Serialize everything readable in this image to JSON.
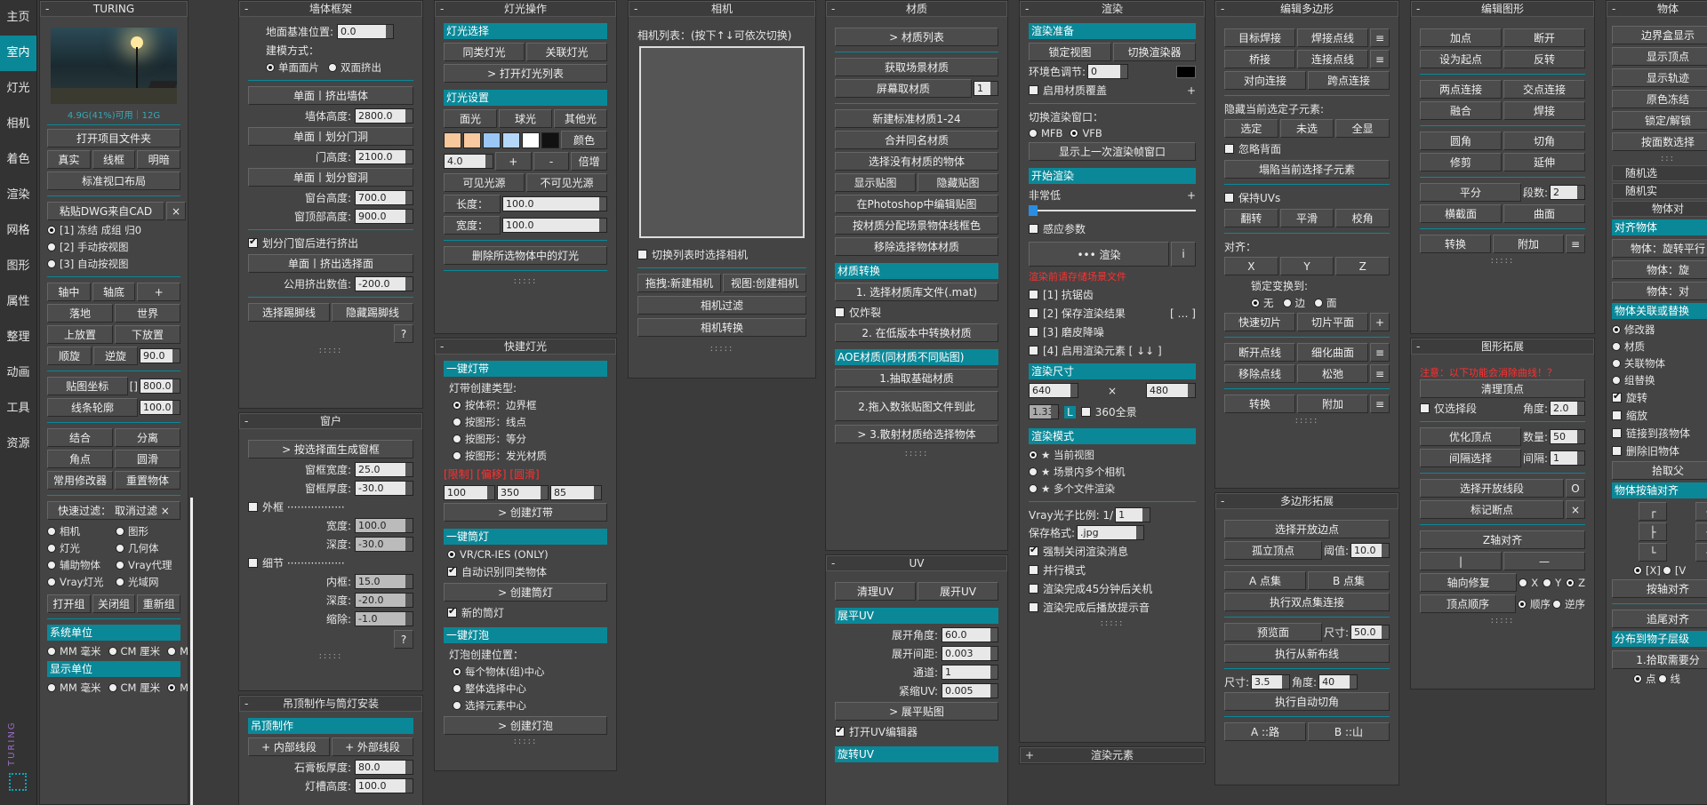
{
  "nav": {
    "items": [
      "主页",
      "室内",
      "灯光",
      "相机",
      "着色",
      "渲染",
      "网格",
      "图形",
      "属性",
      "整理",
      "动画",
      "工具",
      "资源"
    ],
    "active": "室内",
    "logo": "TURING"
  },
  "turing": {
    "title": "TURING",
    "mem": "4.9G(41%)可用｜12G",
    "open_folder": "打开项目文件夹",
    "modes": [
      "真实",
      "线框",
      "明暗"
    ],
    "std_layout": "标准视口布局",
    "paste_dwg": "粘贴DWG来自CAD",
    "close": "×",
    "paste_opts": [
      "[1] 冻结 成组 归0",
      "[2] 手动按视图",
      "[3] 自动按视图"
    ],
    "axis": [
      "轴中",
      "轴底",
      "+"
    ],
    "ground": "落地",
    "world": "世界",
    "up": "上放置",
    "down": "下放置",
    "cw": "顺旋",
    "ccw": "逆旋",
    "rot": "90.0",
    "map_coord": "贴图坐标",
    "bracket": "[]",
    "map_val": "800.0",
    "outline": "线条轮廓",
    "outline_val": "100.0",
    "combine": "结合",
    "separate": "分离",
    "corner": "角点",
    "smooth": "圆滑",
    "common_mod": "常用修改器",
    "reset_obj": "重置物体",
    "filter": "快速过滤：  取消过滤 ×",
    "filters": [
      "相机",
      "图形",
      "灯光",
      "几何体",
      "辅助物体",
      "Vray代理",
      "Vray灯光",
      "光域网"
    ],
    "group_btns": [
      "打开组",
      "关闭组",
      "重新组"
    ],
    "sys_unit": "系统单位",
    "units": [
      "MM 毫米",
      "CM 厘米",
      "M 米"
    ],
    "disp_unit": "显示单位"
  },
  "wall": {
    "title": "墙体框架",
    "base_label": "地面基准位置:",
    "base_val": "0.0",
    "method": "建模方式：",
    "m1": "单面面片",
    "m2": "双面挤出",
    "b1": "单面丨挤出墙体",
    "wh_label": "墙体高度:",
    "wh": "2800.0",
    "b2": "单面丨划分门洞",
    "dh_label": "门高度:",
    "dh": "2100.0",
    "b3": "单面丨划分窗洞",
    "sill_label": "窗台高度:",
    "sill": "700.0",
    "top_label": "窗顶部高度:",
    "top": "900.0",
    "split": "划分门窗后进行挤出",
    "b4": "单面丨挤出选择面",
    "pub_label": "公用挤出数值:",
    "pub": "-200.0",
    "sel_kick": "选择踢脚线",
    "hide_kick": "隐藏踢脚线",
    "q": "?",
    "win_title": "窗户",
    "win_gen": "> 按选择面生成窗框",
    "wf_w_l": "窗框宽度:",
    "wf_w": "25.0",
    "wf_d_l": "窗框厚度:",
    "wf_d": "-30.0",
    "outer": "外框 ·················",
    "ow_l": "宽度:",
    "ow": "100.0",
    "od_l": "深度:",
    "od": "-30.0",
    "detail": "细节 ·················",
    "iw_l": "内框:",
    "iw": "15.0",
    "id_l": "深度:",
    "id": "-20.0",
    "sh_l": "缩除:",
    "sh": "-1.0",
    "ceiling_title": "吊顶制作与筒灯安装",
    "ceil_sec": "吊顶制作",
    "inner_line": "+ 内部线段",
    "outer_line": "+ 外部线段",
    "gyp_l": "石膏板厚度:",
    "gyp": "80.0",
    "lb_l": "灯槽高度:",
    "lb": "100.0"
  },
  "light": {
    "title": "灯光操作",
    "sel_sec": "灯光选择",
    "same": "同类灯光",
    "assoc": "关联灯光",
    "open_list": "> 打开灯光列表",
    "set_sec": "灯光设置",
    "types": [
      "面光",
      "球光",
      "其他光"
    ],
    "swatches": [
      "#f7c89b",
      "#f9c8a0",
      "#9ac6f6",
      "#b4d6f9",
      "#ffffff",
      "#111111"
    ],
    "color": "颜色",
    "mult": "4.0",
    "plus": "+",
    "minus": "-",
    "fold": "倍增",
    "vis": "可见光源",
    "invis": "不可见光源",
    "len_l": "长度：",
    "len": "100.0",
    "wid_l": "宽度：",
    "wid": "100.0",
    "del_all": "删除所选物体中的灯光",
    "quick_title": "快建灯光",
    "strip_sec": "一键灯带",
    "strip_type": "灯带创建类型:",
    "strip_opts": [
      "按体积：边界框",
      "按图形：线点",
      "按图形：等分",
      "按图形：发光材质"
    ],
    "strip_red": "[限制] [偏移] [圆滑]",
    "s1": "100",
    "s2": "350",
    "s3": "85",
    "create_strip": "> 创建灯带",
    "tube_sec": "一键筒灯",
    "tube_opt": "VR/CR-IES (ONLY)",
    "tube_auto": "自动识别同类物体",
    "create_tube": "> 创建筒灯",
    "new_tube": "新的筒灯",
    "bulb_sec": "一键灯泡",
    "bulb_pos": "灯泡创建位置：",
    "bulb_opts": [
      "每个物体(组)中心",
      "整体选择中心",
      "选择元素中心"
    ],
    "create_bulb": "> 创建灯泡"
  },
  "camera": {
    "title": "相机",
    "list": "相机列表：(按下↑↓可依次切换)",
    "toggle": "切换列表时选择相机",
    "drag": "拖拽:新建相机",
    "view": "视图:创建相机",
    "filter": "相机过滤",
    "convert": "相机转换"
  },
  "material": {
    "title": "材质",
    "list": "> 材质列表",
    "get_scene": "获取场景材质",
    "screen": "屏幕取材质",
    "screen_n": "1",
    "new_std": "新建标准材质1-24",
    "merge": "合并同名材质",
    "sel_nomat": "选择没有材质的物体",
    "show_map": "显示贴图",
    "hide_map": "隐藏贴图",
    "ps_edit": "在Photoshop中编辑贴图",
    "assign_color": "按材质分配场景物体线框色",
    "remove": "移除选择物体材质",
    "conv_sec": "材质转换",
    "c1": "1. 选择材质库文件(.mat)",
    "only_bake": "仅炸裂",
    "c2": "2. 在低版本中转换材质",
    "aoe_sec": "AOE材质(同材质不同贴图)",
    "a1": "1.抽取基础材质",
    "a2": "2.拖入数张贴图文件到此",
    "a3": "> 3.散射材质给选择物体",
    "uv_title": "UV",
    "clear_uv": "清理UV",
    "unwrap": "展开UV",
    "unwrap_sec": "展平UV",
    "ua_l": "展开角度:",
    "ua": "60.0",
    "ud_l": "展开间距:",
    "ud": "0.003",
    "ch_l": "通道:",
    "ch": "1",
    "tight_l": "紧缩UV:",
    "tight": "0.005",
    "flat_map": "> 展平贴图",
    "open_uv": "打开UV编辑器",
    "rot_sec": "旋转UV"
  },
  "render": {
    "title": "渲染",
    "prep_sec": "渲染准备",
    "lock_view": "锁定视图",
    "switch_r": "切换渲染器",
    "env_l": "环境色调节:",
    "env": "0",
    "override": "启用材质覆盖",
    "plus": "+",
    "switch_win": "切换渲染窗口：",
    "mfb": "MFB",
    "vfb": "VFB",
    "show_last": "显示上一次渲染帧窗口",
    "start_sec": "开始渲染",
    "quality": "非常低",
    "sens": "感应参数",
    "render_btn": "••• 渲染",
    "info": "i",
    "red_note": "渲染前请存储场景文件",
    "o1": "[1] 抗锯齿",
    "o2": "[2] 保存渲染结果",
    "o2b": "[ … ]",
    "o3": "[3] 磨皮降噪",
    "o4": "[4] 启用渲染元素 [ ↓↓ ]",
    "size_sec": "渲染尺寸",
    "w": "640",
    "x": "×",
    "h": "480",
    "lb": "1.333",
    "lock": "L",
    "pano": "360全景",
    "mode_sec": "渲染模式",
    "modes": [
      "★ 当前视图",
      "★ 场景内多个相机",
      "★ 多个文件渲染"
    ],
    "photon_l": "Vray光子比例: 1/",
    "photon": "1",
    "fmt_l": "保存格式:",
    "fmt": ".jpg",
    "f1": "强制关闭渲染消息",
    "f2": "并行模式",
    "f3": "渲染完成45分钟后关机",
    "f4": "渲染完成后播放提示音",
    "elements": "渲染元素"
  },
  "editpoly": {
    "title": "编辑多边形",
    "r1": [
      "目标焊接",
      "焊接点线",
      "≡"
    ],
    "r2": [
      "桥接",
      "连接点线",
      "≡"
    ],
    "r3": [
      "对向连接",
      "跨点连接"
    ],
    "hide_label": "隐藏当前选定子元素:",
    "r4": [
      "选定",
      "未选",
      "全显"
    ],
    "ignore_back": "忽略背面",
    "collapse": "塌陷当前选择子元素",
    "keep_uv": "保持UVs",
    "r5": [
      "翻转",
      "平滑",
      "校角"
    ],
    "align": "对齐：",
    "xyz": [
      "X",
      "Y",
      "Z"
    ],
    "lock_to": "锁定变换到:",
    "lock_opts": [
      "无",
      "边",
      "面"
    ],
    "r6": [
      "快速切片",
      "切片平面",
      "+"
    ],
    "r7": [
      "断开点线",
      "细化曲面",
      "≡"
    ],
    "r8": [
      "移除点线",
      "松弛",
      "≡"
    ],
    "r9": [
      "转换",
      "附加",
      "≡"
    ],
    "ext_title": "多边形拓展",
    "sel_open": "选择开放边点",
    "iso": "孤立顶点",
    "thr_l": "阈值:",
    "thr": "10.0",
    "ptA": "A 点集",
    "ptB": "B 点集",
    "dual": "执行双点集连接",
    "preview": "预览面",
    "sz_l": "尺寸:",
    "sz": "50.0",
    "layout": "执行从新布线",
    "sz2_l": "尺寸:",
    "sz2": "3.5",
    "ang_l": "角度:",
    "ang": "40",
    "auto": "执行自动切角",
    "pathA": "A ::路",
    "pathB": "B ::山"
  },
  "editshape": {
    "title": "编辑图形",
    "r1": [
      "加点",
      "断开"
    ],
    "r2": [
      "设为起点",
      "反转"
    ],
    "r3": [
      "两点连接",
      "交点连接"
    ],
    "r4": [
      "融合",
      "焊接"
    ],
    "r5": [
      "圆角",
      "切角"
    ],
    "r6": [
      "修剪",
      "延伸"
    ],
    "avg": "平分",
    "seg_l": "段数:",
    "seg": "2",
    "r7": [
      "横截面",
      "曲面"
    ],
    "r8": [
      "转换",
      "附加",
      "≡"
    ],
    "ext_title": "图形拓展",
    "red": "注意：以下功能会消除曲线！？",
    "clean": "清理顶点",
    "only_seg": "仅选择段",
    "ang_l": "角度:",
    "ang": "2.0",
    "opt_v": "优化顶点",
    "cnt_l": "数量:",
    "cnt": "50",
    "intv": "间隔选择",
    "gap_l": "间隔:",
    "gap": "1",
    "sel_open": "选择开放线段",
    "o": "O",
    "mark": "标记断点",
    "x": "×",
    "zaxis": "Z轴对齐",
    "bar": "|",
    "dash": "—",
    "axis_fix": "轴向修复",
    "axes": [
      "X",
      "Y",
      "Z"
    ],
    "v_order": "顶点顺序",
    "order": "顺序",
    "reverse": "逆序"
  },
  "physics": {
    "title": "物体",
    "b1": "边界盒显示",
    "b2": "显示顶点",
    "b3": "显示轨迹",
    "b4": "原色冻结",
    "b5": "锁定/解锁",
    "b6": "按面数选择",
    "rand1": "随机选",
    "rand2": "随机实",
    "objs": "物体对",
    "align_sec": "对齐物体",
    "ob1": "物体：旋转平行",
    "ob2": "物体：旋",
    "ob3": "物体：对",
    "link_sec": "物体关联或替换",
    "link_opts": [
      "修改器",
      "材质",
      "关联物体",
      "组替换"
    ],
    "rot": "旋转",
    "scale": "缩放",
    "link_child": "链接到孩物体",
    "del_old": "删除旧物体",
    "pick": "拾取父",
    "axis_sec": "物体按轴对齐",
    "grid": [
      "┌",
      "┬",
      "├",
      "┼",
      "└",
      "┴"
    ],
    "xb": "[X]",
    "xv": "[V",
    "axis_align": "按轴对齐",
    "trail": "追尾对齐",
    "dist_sec": "分布到物子层级",
    "pick2": "1.拾取需要分",
    "dot": "点",
    "line": "线"
  }
}
